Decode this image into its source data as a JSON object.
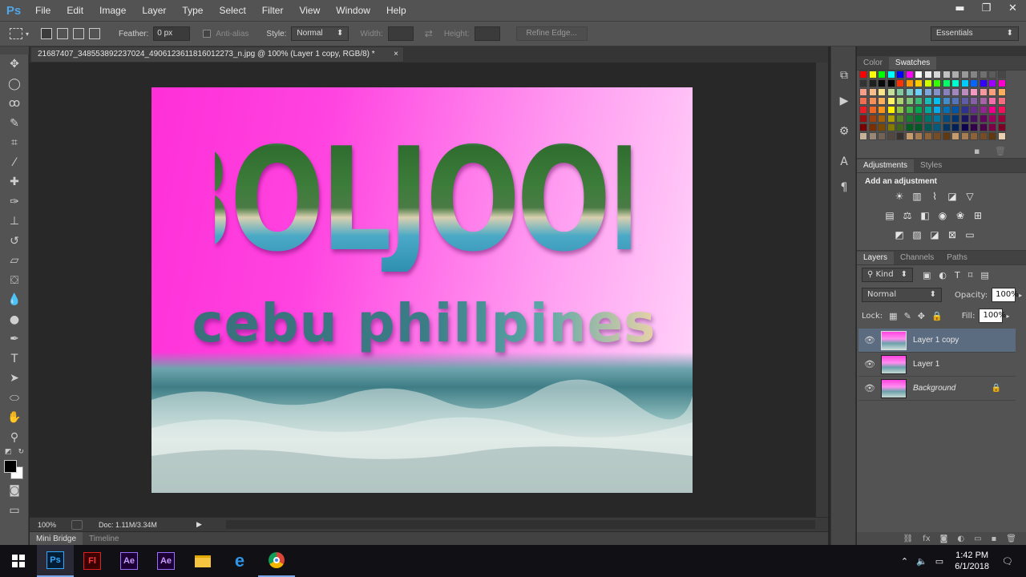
{
  "app": {
    "logo": "Ps"
  },
  "menu": [
    "File",
    "Edit",
    "Image",
    "Layer",
    "Type",
    "Select",
    "Filter",
    "View",
    "Window",
    "Help"
  ],
  "window_controls": {
    "minimize": "▬",
    "restore": "❐",
    "close": "✕"
  },
  "options": {
    "feather_label": "Feather:",
    "feather_value": "0 px",
    "antialias_label": "Anti-alias",
    "style_label": "Style:",
    "style_value": "Normal",
    "width_label": "Width:",
    "height_label": "Height:",
    "refine_edge": "Refine Edge...",
    "workspace": "Essentials"
  },
  "document": {
    "tab_title": "21687407_348553892237024_4906123611816012273_n.jpg @ 100% (Layer 1 copy, RGB/8) *",
    "close": "×"
  },
  "artwork": {
    "title_text": "BOLJOON",
    "subtitle_text": "cebu phillpines"
  },
  "status": {
    "zoom": "100%",
    "doc": "Doc: 1.11M/3.34M"
  },
  "bottom_tabs": [
    "Mini Bridge",
    "Timeline"
  ],
  "color_panel": {
    "tabs": [
      "Color",
      "Swatches"
    ]
  },
  "adjustments_panel": {
    "tabs": [
      "Adjustments",
      "Styles"
    ],
    "heading": "Add an adjustment"
  },
  "layers_panel": {
    "tabs": [
      "Layers",
      "Channels",
      "Paths"
    ],
    "kind": "Kind",
    "blend_mode": "Normal",
    "opacity_label": "Opacity:",
    "opacity_value": "100%",
    "lock_label": "Lock:",
    "fill_label": "Fill:",
    "fill_value": "100%",
    "layers": [
      {
        "name": "Layer 1 copy",
        "selected": true,
        "locked": false
      },
      {
        "name": "Layer 1",
        "selected": false,
        "locked": false
      },
      {
        "name": "Background",
        "selected": false,
        "locked": true
      }
    ]
  },
  "taskbar": {
    "apps": [
      "Ps",
      "Fl",
      "Ae",
      "Ae"
    ],
    "time": "1:42 PM",
    "date": "6/1/2018"
  },
  "colors": {
    "accent": "#4fa6e8",
    "selected_layer": "#5b6b80",
    "pink": "#ff2fd8"
  }
}
